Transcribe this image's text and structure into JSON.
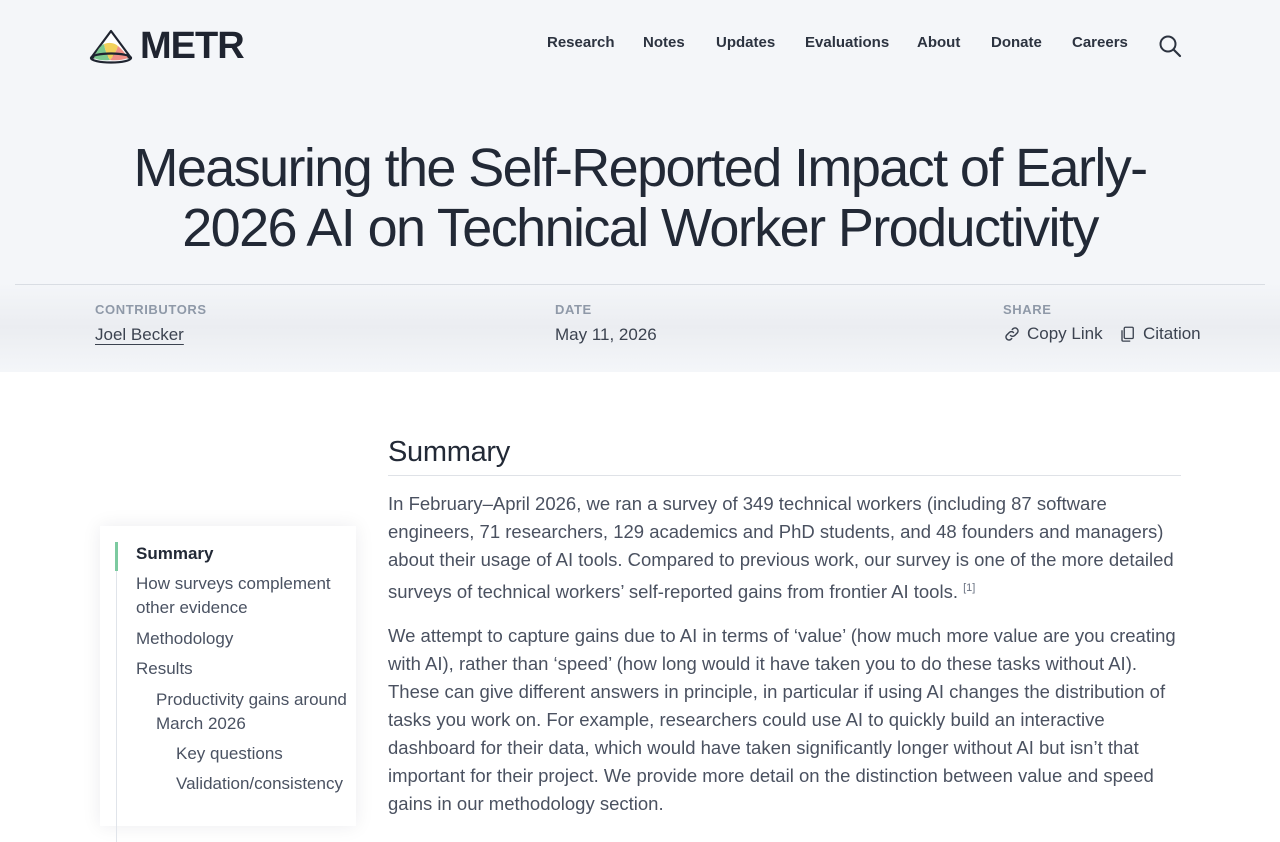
{
  "header": {
    "logo_text": "METR",
    "nav": [
      "Research",
      "Notes",
      "Updates",
      "Evaluations",
      "About",
      "Donate",
      "Careers"
    ],
    "search_icon": "search-icon"
  },
  "article": {
    "title": "Measuring the Self-Reported Impact of Early-2026 AI on Technical Worker Productivity",
    "contributors_label": "CONTRIBUTORS",
    "contributor": "Joel Becker",
    "date_label": "DATE",
    "date": "May 11, 2026",
    "share_label": "SHARE",
    "copy_link": "Copy Link",
    "citation": "Citation"
  },
  "toc": [
    {
      "label": "Summary",
      "level": 0,
      "active": true
    },
    {
      "label": "How surveys complement other evidence",
      "level": 0,
      "active": false
    },
    {
      "label": "Methodology",
      "level": 0,
      "active": false
    },
    {
      "label": "Results",
      "level": 0,
      "active": false
    },
    {
      "label": "Productivity gains around March 2026",
      "level": 1,
      "active": false
    },
    {
      "label": "Key questions",
      "level": 2,
      "active": false
    },
    {
      "label": "Validation/consistency",
      "level": 2,
      "active": false
    }
  ],
  "content": {
    "heading": "Summary",
    "p1": "In February–April 2026, we ran a survey of 349 technical workers (including 87 software engineers, 71 researchers, 129 academics and PhD students, and 48 founders and managers) about their usage of AI tools. Compared to previous work, our survey is one of the more detailed surveys of technical workers’ self-reported gains from frontier AI tools.",
    "footnote": "[1]",
    "p2": "We attempt to capture gains due to AI in terms of ‘value’ (how much more value are you creating with AI), rather than ‘speed’ (how long would it have taken you to do these tasks without AI). These can give different answers in principle, in particular if using AI changes the distribution of tasks you work on. For example, researchers could use AI to quickly build an interactive dashboard for their data, which would have taken significantly longer without AI but isn’t that important for their project. We provide more detail on the distinction between value and speed gains in our methodology section."
  }
}
